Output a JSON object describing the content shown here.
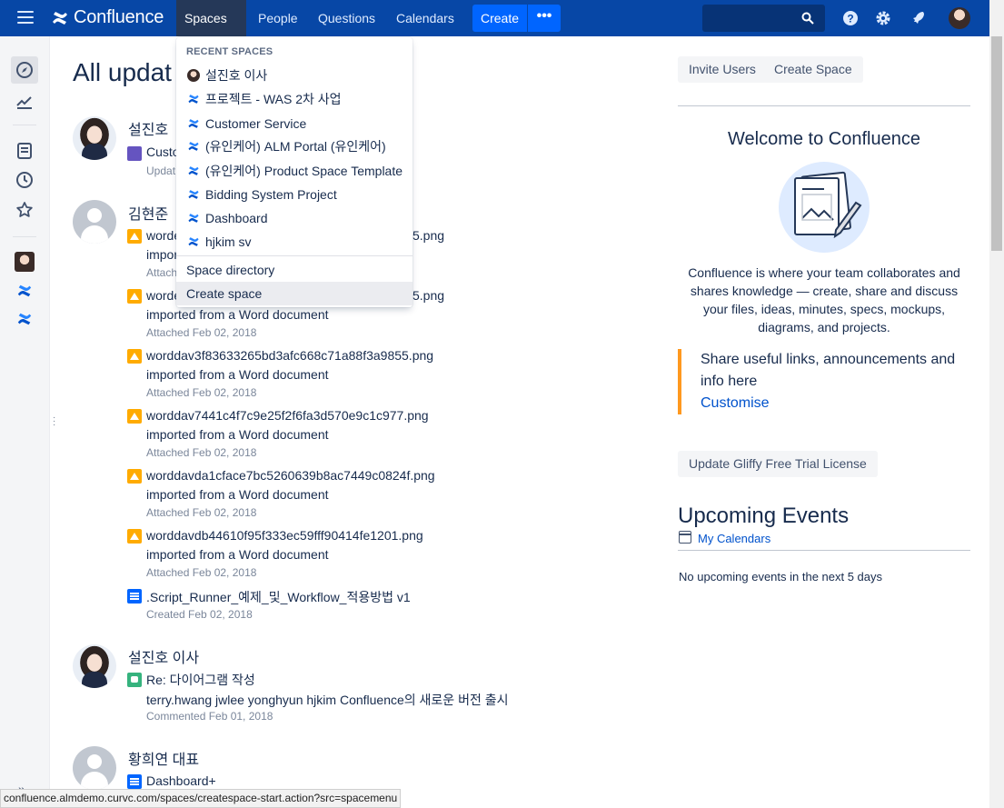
{
  "app": {
    "name": "Confluence",
    "brand_color": "#0747a6",
    "accent_color": "#0065ff"
  },
  "nav": {
    "spaces": "Spaces",
    "people": "People",
    "questions": "Questions",
    "calendars": "Calendars",
    "create": "Create",
    "more": "•••",
    "search_placeholder": ""
  },
  "dropdown": {
    "heading": "RECENT SPACES",
    "items": [
      {
        "label": "설진호 이사",
        "icon": "user-avatar-icon"
      },
      {
        "label": "프로젝트 - WAS 2차 사업",
        "icon": "confluence-space-icon"
      },
      {
        "label": "Customer Service",
        "icon": "confluence-space-icon"
      },
      {
        "label": "(유인케어) ALM Portal (유인케어)",
        "icon": "confluence-space-icon"
      },
      {
        "label": "(유인케어) Product Space Template",
        "icon": "confluence-space-icon"
      },
      {
        "label": "Bidding System Project",
        "icon": "confluence-space-icon"
      },
      {
        "label": "Dashboard",
        "icon": "confluence-space-icon"
      },
      {
        "label": "hjkim sv",
        "icon": "confluence-space-icon"
      }
    ],
    "directory": "Space directory",
    "create_space": "Create space"
  },
  "feed": {
    "title": "All updat",
    "groups": [
      {
        "author": "설진호",
        "entries": [
          {
            "title": "Custo",
            "desc": "",
            "meta": "Updat",
            "icon": "space-icon"
          }
        ]
      },
      {
        "author": "김현준",
        "entries": [
          {
            "title": "worde",
            "suffix": "5.png",
            "desc": "importe",
            "meta": "Attach",
            "icon": "image-icon"
          },
          {
            "title": "worde",
            "suffix": "5.png",
            "desc": "imported from a Word document",
            "meta": "Attached Feb 02, 2018",
            "icon": "image-icon"
          },
          {
            "title": "worddav3f83633265bd3afc668c71a88f3a9855.png",
            "desc": "imported from a Word document",
            "meta": "Attached Feb 02, 2018",
            "icon": "image-icon"
          },
          {
            "title": "worddav7441c4f7c9e25f2f6fa3d570e9c1c977.png",
            "desc": "imported from a Word document",
            "meta": "Attached Feb 02, 2018",
            "icon": "image-icon"
          },
          {
            "title": "worddavda1cface7bc5260639b8ac7449c0824f.png",
            "desc": "imported from a Word document",
            "meta": "Attached Feb 02, 2018",
            "icon": "image-icon"
          },
          {
            "title": "worddavdb44610f95f333ec59fff90414fe1201.png",
            "desc": "imported from a Word document",
            "meta": "Attached Feb 02, 2018",
            "icon": "image-icon"
          },
          {
            "title": ".Script_Runner_예제_및_Workflow_적용방법 v1",
            "desc": "",
            "meta": "Created Feb 02, 2018",
            "icon": "page-icon"
          }
        ]
      },
      {
        "author": "설진호 이사",
        "entries": [
          {
            "title": "Re: 다이어그램 작성",
            "desc": "terry.hwang jwlee yonghyun hjkim Confluence의 새로운 버전 출시",
            "meta": "Commented Feb 01, 2018",
            "icon": "comment-icon"
          }
        ]
      },
      {
        "author": "황희연 대표",
        "entries": [
          {
            "title": "Dashboard+",
            "desc": "",
            "meta": "",
            "icon": "page-icon"
          }
        ]
      }
    ]
  },
  "sidebar": {
    "invite_users": "Invite Users",
    "create_space": "Create Space",
    "welcome_title": "Welcome to Confluence",
    "welcome_text": "Confluence is where your team collaborates and shares knowledge — create, share and discuss your files, ideas, minutes, specs, mockups, diagrams, and projects.",
    "share_text": "Share useful links, announcements and info here",
    "customise": "Customise",
    "gliffy": "Update Gliffy Free Trial License",
    "events_title": "Upcoming Events",
    "my_calendars": "My Calendars",
    "no_events": "No upcoming events in the next 5 days"
  },
  "rail": {
    "collapse": "»"
  },
  "status_url": "confluence.almdemo.curvc.com/spaces/createspace-start.action?src=spacemenu"
}
